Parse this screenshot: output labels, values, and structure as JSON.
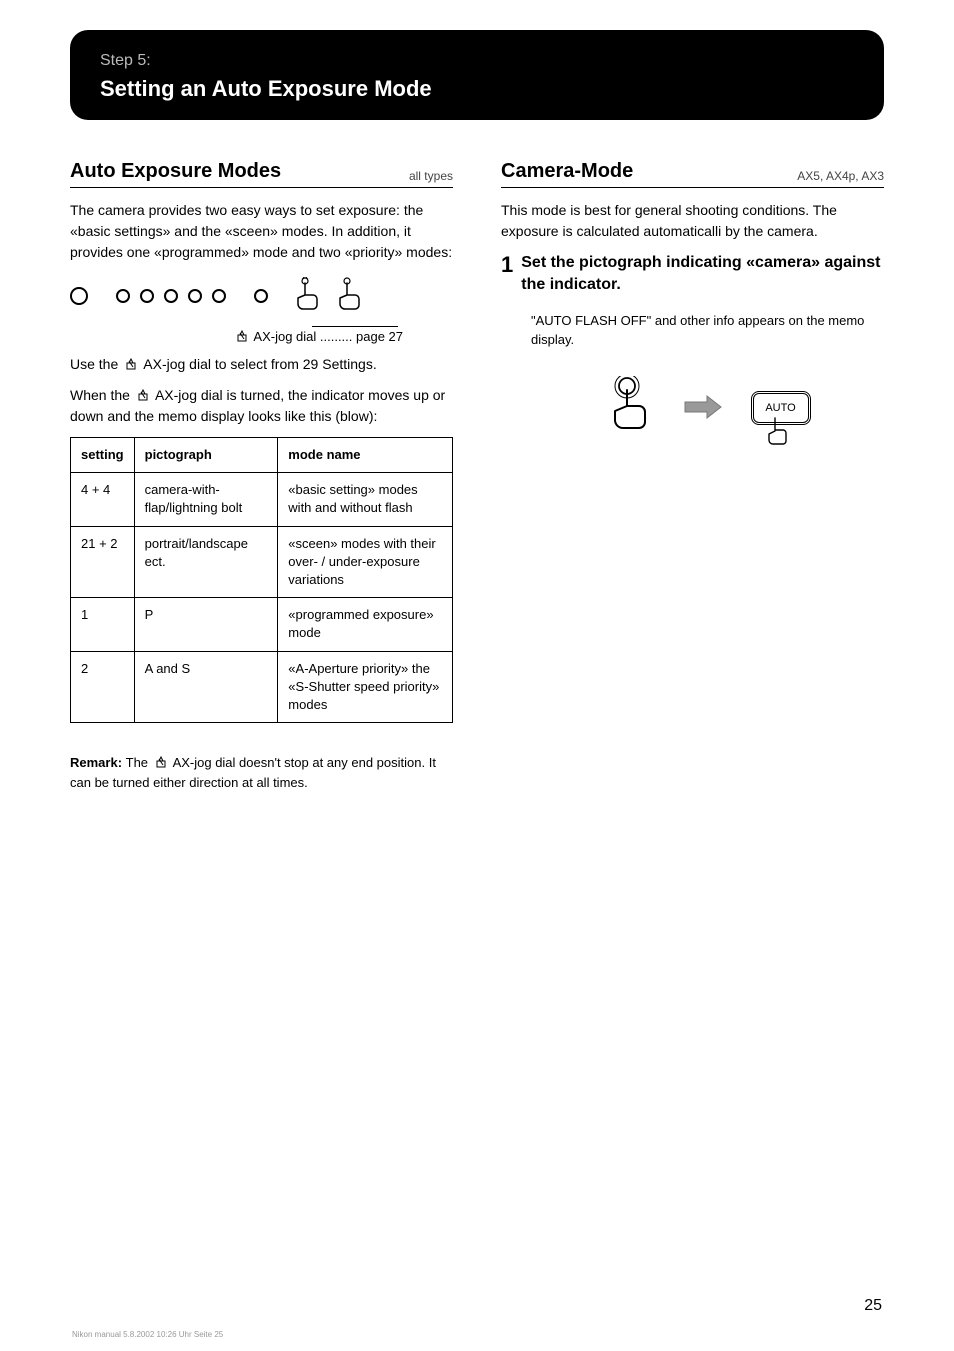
{
  "banner": {
    "step": "Step 5:",
    "title": "Setting an Auto Exposure Mode"
  },
  "left": {
    "heading": "Auto Exposure Modes",
    "subtitle": "all types",
    "illus_caption": "AX-jog dial ......... page 27",
    "intro_p1_a": "Use the ",
    "intro_p1_b": "AX-jog dial to select from 29 Settings.",
    "intro_p2_a": "When the ",
    "intro_p2_b": "AX-jog dial is turned, the indicator moves up or down and the memo display looks like this (blow):",
    "table": {
      "headers": [
        "setting",
        "pictograph",
        "mode name"
      ],
      "rows": [
        {
          "setting": "4 + 4",
          "pictograph": "camera-with-flap/lightning bolt",
          "mode": "«basic setting» modes with and without flash"
        },
        {
          "setting": "21 + 2",
          "pictograph": "portrait/landscape ect.",
          "mode": "«sceen» modes with their over- / under-exposure variations"
        },
        {
          "setting": "1",
          "pictograph": "P",
          "mode": "«programmed exposure» mode"
        },
        {
          "setting": "2",
          "pictograph": "A and S",
          "mode": "«A-Aperture priority» the «S-Shutter speed priority» modes"
        }
      ]
    },
    "remark_label": "Remark: ",
    "remark_text_a": "The ",
    "remark_text_b": "AX-jog dial doesn't stop at any end position. It can be turned either direction at all times."
  },
  "right": {
    "heading": "Camera-Mode",
    "subtitle": "AX5, AX4p, AX3",
    "intro": "This mode is best for general shooting conditions. The exposure is calculated automaticalli by the camera.",
    "step_num": "1",
    "step_text": "Set the pictograph indicating «camera» against the indicator.",
    "step_result": "\"AUTO FLASH OFF\" and other info appears on the memo display.",
    "button_label": "AUTO"
  },
  "page_number": "25",
  "manual_name": "Nikon manual 5.8.2002 10:26 Uhr Seite 25"
}
